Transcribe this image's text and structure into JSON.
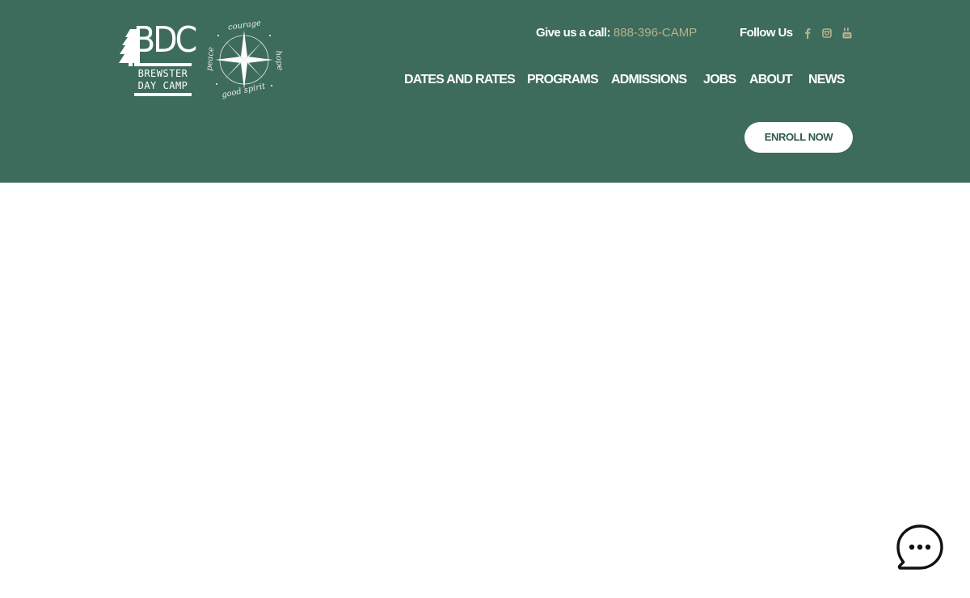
{
  "logo": {
    "letters": "BDC",
    "line1": "BREWSTER",
    "line2": "DAY CAMP"
  },
  "badge": {
    "top": "courage",
    "left": "peace",
    "right": "hope",
    "bottom": "good spirit"
  },
  "contact": {
    "call_label": "Give us a call:",
    "phone": "888-396-CAMP",
    "follow_label": "Follow Us"
  },
  "social": [
    "facebook-icon",
    "instagram-icon",
    "youtube-icon"
  ],
  "nav": {
    "items": [
      {
        "label": "DATES AND RATES"
      },
      {
        "label": "PROGRAMS"
      },
      {
        "label": "ADMISSIONS"
      },
      {
        "label": "JOBS"
      },
      {
        "label": "ABOUT"
      },
      {
        "label": "NEWS"
      }
    ]
  },
  "cta": {
    "enroll_label": "ENROLL NOW"
  },
  "colors": {
    "header_bg": "#3d6b5c",
    "phone_accent": "#b7b38c",
    "button_text": "#2e5a4c",
    "page_bg": "#ffffff"
  }
}
